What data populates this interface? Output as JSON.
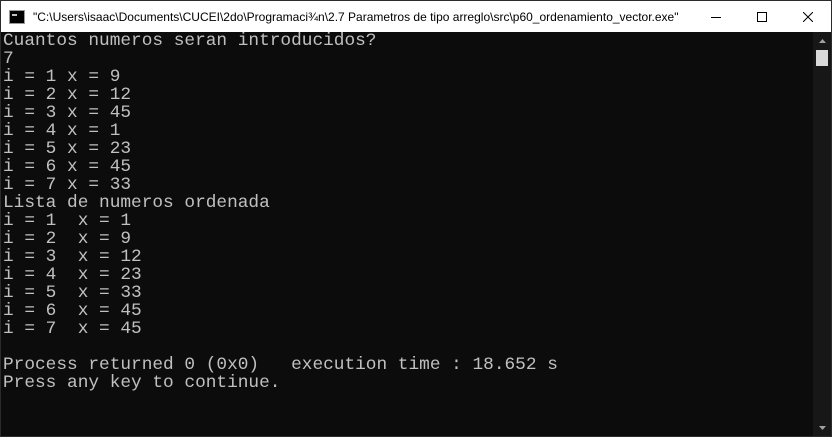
{
  "window": {
    "title": "\"C:\\Users\\isaac\\Documents\\CUCEI\\2do\\Programaci¾n\\2.7 Parametros de tipo arreglo\\src\\p60_ordenamiento_vector.exe\""
  },
  "controls": {
    "minimize_icon": "minimize-icon",
    "maximize_icon": "maximize-icon",
    "close_icon": "close-icon"
  },
  "console": {
    "lines": [
      "Cuantos numeros seran introducidos?",
      "7",
      "i = 1 x = 9",
      "i = 2 x = 12",
      "i = 3 x = 45",
      "i = 4 x = 1",
      "i = 5 x = 23",
      "i = 6 x = 45",
      "i = 7 x = 33",
      "Lista de numeros ordenada",
      "i = 1  x = 1",
      "i = 2  x = 9",
      "i = 3  x = 12",
      "i = 4  x = 23",
      "i = 5  x = 33",
      "i = 6  x = 45",
      "i = 7  x = 45",
      "",
      "Process returned 0 (0x0)   execution time : 18.652 s",
      "Press any key to continue."
    ]
  },
  "colors": {
    "console_background": "#0c0c0c",
    "console_text": "#c0c0c0",
    "titlebar_background": "#ffffff"
  }
}
